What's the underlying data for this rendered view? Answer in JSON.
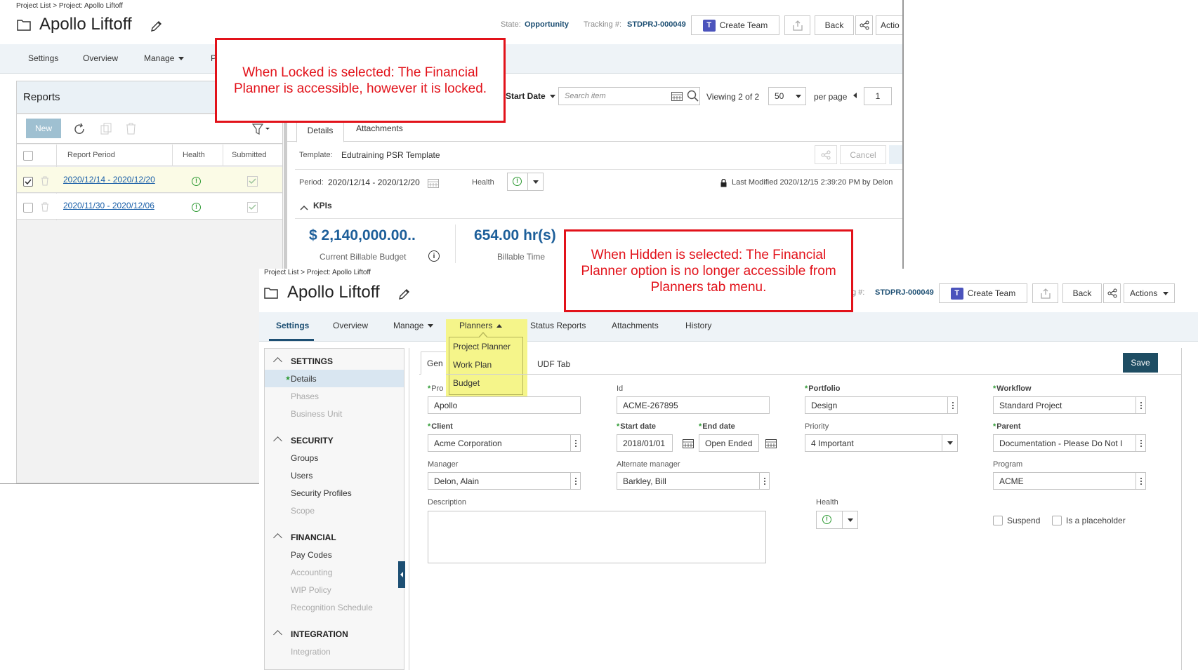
{
  "back_screen": {
    "breadcrumb": "Project List > Project: Apollo Liftoff",
    "title": "Apollo Liftoff",
    "state_label": "State:",
    "state_value": "Opportunity",
    "tracking_label": "Tracking #:",
    "tracking_value": "STDPRJ-000049",
    "create_team_label": "Create Team",
    "back_label": "Back",
    "actions_label": "Actio",
    "nav": {
      "settings": "Settings",
      "overview": "Overview",
      "manage": "Manage",
      "partial": "P"
    },
    "reports": {
      "panel_title": "Reports",
      "new_label": "New",
      "columns": [
        "Report Period",
        "Health",
        "Submitted"
      ],
      "rows": [
        {
          "period": "2020/12/14 - 2020/12/20"
        },
        {
          "period": "2020/11/30 - 2020/12/06"
        }
      ]
    },
    "list_bar": {
      "sort_label": "Start Date",
      "search_placeholder": "Search item",
      "viewing_prefix": "Viewing",
      "viewing_value": "2 of 2",
      "per_page_value": "50",
      "per_page_label": "per page",
      "page_value": "1"
    },
    "detail_tabs": [
      "Details",
      "Attachments"
    ],
    "template_label": "Template:",
    "template_value": "Edutraining PSR Template",
    "cancel_label": "Cancel",
    "period_label": "Period:",
    "period_value": "2020/12/14 - 2020/12/20",
    "health_label": "Health",
    "last_modified": "Last Modified 2020/12/15 2:39:20 PM by Delon",
    "kpis_label": "KPIs",
    "kpi_budget_value": "$ 2,140,000.00..",
    "kpi_budget_label": "Current Billable Budget",
    "kpi_time_value": "654.00 hr(s)",
    "kpi_time_label": "Billable Time"
  },
  "callouts": {
    "locked": "When Locked is selected: The Financial Planner is accessible, however it is locked.",
    "hidden": "When Hidden is selected: The Financial Planner option is no longer accessible from Planners tab menu."
  },
  "front_screen": {
    "breadcrumb": "Project List > Project: Apollo Liftoff",
    "title": "Apollo Liftoff",
    "tracking_label": "g #:",
    "tracking_value": "STDPRJ-000049",
    "create_team_label": "Create Team",
    "back_label": "Back",
    "actions_label": "Actions",
    "nav": {
      "settings": "Settings",
      "overview": "Overview",
      "manage": "Manage",
      "planners": "Planners",
      "status_reports": "Status Reports",
      "attachments": "Attachments",
      "history": "History"
    },
    "planners_menu": [
      "Project Planner",
      "Work Plan",
      "Budget"
    ],
    "sidebar": {
      "settings_head": "SETTINGS",
      "settings_items": [
        "Details",
        "Phases",
        "Business Unit"
      ],
      "security_head": "SECURITY",
      "security_items": [
        "Groups",
        "Users",
        "Security Profiles",
        "Scope"
      ],
      "financial_head": "FINANCIAL",
      "financial_items": [
        "Pay Codes",
        "Accounting",
        "WIP Policy",
        "Recognition Schedule"
      ],
      "integration_head": "INTEGRATION",
      "integration_items": [
        "Integration"
      ]
    },
    "form_tabs": [
      "Gen",
      "UDF Tab"
    ],
    "save_label": "Save",
    "fields": {
      "project_label": "Pro",
      "project_value": "Apollo",
      "id_label": "Id",
      "id_value": "ACME-267895",
      "portfolio_label": "Portfolio",
      "portfolio_value": "Design",
      "workflow_label": "Workflow",
      "workflow_value": "Standard Project",
      "client_label": "Client",
      "client_value": "Acme Corporation",
      "start_label": "Start date",
      "start_value": "2018/01/01",
      "end_label": "End date",
      "end_value": "Open Ended",
      "priority_label": "Priority",
      "priority_value": "4 Important",
      "parent_label": "Parent",
      "parent_value": "Documentation - Please Do Not I",
      "manager_label": "Manager",
      "manager_value": "Delon, Alain",
      "alt_manager_label": "Alternate manager",
      "alt_manager_value": "Barkley, Bill",
      "program_label": "Program",
      "program_value": "ACME",
      "description_label": "Description",
      "health_label": "Health",
      "suspend_label": "Suspend",
      "placeholder_label": "Is a placeholder"
    }
  },
  "colors": {
    "accent_blue": "#1d4f73",
    "link_blue": "#1a5fa8",
    "callout_red": "#e2121a",
    "highlight_yellow": "#f5f58a",
    "save_button": "#1e4d63",
    "health_green": "#2e9a33"
  }
}
